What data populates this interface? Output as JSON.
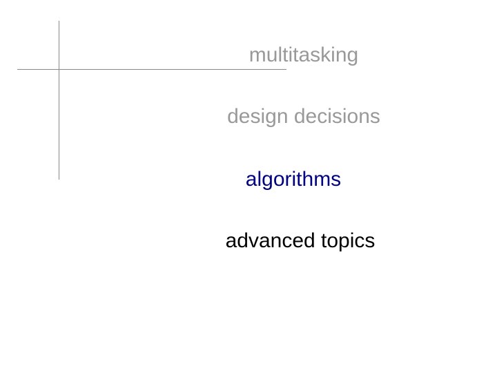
{
  "lines": {
    "l1": "multitasking",
    "l2": "design decisions",
    "l3": "algorithms",
    "l4": "advanced topics"
  }
}
